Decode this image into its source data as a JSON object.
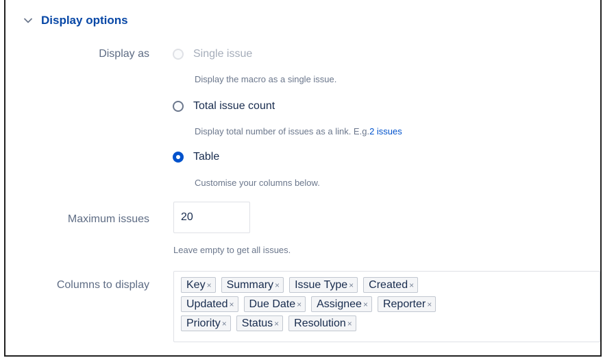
{
  "section": {
    "title": "Display options",
    "icon": "chevron-down-icon"
  },
  "display_as": {
    "label": "Display as",
    "options": [
      {
        "label": "Single issue",
        "help": "Display the macro as a single issue.",
        "state": "disabled"
      },
      {
        "label": "Total issue count",
        "help": "Display total number of issues as a link. E.g.",
        "help_link": "2 issues",
        "state": "unchecked"
      },
      {
        "label": "Table",
        "help": "Customise your columns below.",
        "state": "checked"
      }
    ]
  },
  "maximum_issues": {
    "label": "Maximum issues",
    "value": "20",
    "help": "Leave empty to get all issues."
  },
  "columns": {
    "label": "Columns to display",
    "remove_glyph": "×",
    "rows": [
      [
        "Key",
        "Summary",
        "Issue Type",
        "Created"
      ],
      [
        "Updated",
        "Due Date",
        "Assignee",
        "Reporter"
      ],
      [
        "Priority",
        "Status",
        "Resolution"
      ]
    ]
  },
  "colors": {
    "accent": "#0052cc",
    "header": "#0747a6",
    "label": "#5e6c84",
    "help": "#6b778c"
  }
}
